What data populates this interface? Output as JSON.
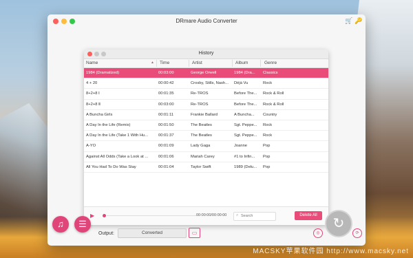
{
  "app": {
    "title": "DRmare Audio Converter",
    "toolbar_icons": [
      "cart-icon",
      "key-icon"
    ]
  },
  "history": {
    "title": "History",
    "columns": [
      "Name",
      "Time",
      "Artist",
      "Album",
      "Genre"
    ],
    "rows": [
      {
        "name": "1984 (Dramatized)",
        "time": "00:03:00",
        "artist": "George Orwell",
        "album": "1984 (Dra...",
        "genre": "Classics",
        "selected": true
      },
      {
        "name": "4 + 20",
        "time": "00:00:42",
        "artist": "Crosby, Stills, Nash...",
        "album": "Déjà Vu",
        "genre": "Rock"
      },
      {
        "name": "8+2+8 Ⅰ",
        "time": "00:01:35",
        "artist": "Re-TROS",
        "album": "Before The...",
        "genre": "Rock & Roll"
      },
      {
        "name": "8+2+8 Ⅱ",
        "time": "00:03:00",
        "artist": "Re-TROS",
        "album": "Before The...",
        "genre": "Rock & Roll"
      },
      {
        "name": "A Buncha Girls",
        "time": "00:01:11",
        "artist": "Frankie Ballard",
        "album": "A Buncha...",
        "genre": "Country"
      },
      {
        "name": "A Day In the Life (Remix)",
        "time": "00:01:50",
        "artist": "The Beatles",
        "album": "Sgt. Peppe...",
        "genre": "Rock"
      },
      {
        "name": "A Day In the Life (Take 1 With Hu...",
        "time": "00:01:37",
        "artist": "The Beatles",
        "album": "Sgt. Peppe...",
        "genre": "Rock"
      },
      {
        "name": "A-YO",
        "time": "00:01:09",
        "artist": "Lady Gaga",
        "album": "Joanne",
        "genre": "Pop"
      },
      {
        "name": "Against All Odds (Take a Look at ...",
        "time": "00:01:06",
        "artist": "Mariah Carey",
        "album": "#1 to Infin...",
        "genre": "Pop"
      },
      {
        "name": "All You Had To Do Was Stay",
        "time": "00:01:04",
        "artist": "Taylor Swift",
        "album": "1989 (Delu...",
        "genre": "Pop"
      }
    ],
    "player": {
      "time_readout": "00:00:00/00:00:00",
      "search_placeholder": "Search",
      "delete_all_label": "Delete All"
    }
  },
  "bottom": {
    "output_label": "Output:",
    "output_value": "Converted"
  },
  "watermark": "MACSKY苹果软件园 http://www.macsky.net",
  "colors": {
    "accent": "#ea4c7a",
    "selected_row": "#ea4c7a"
  }
}
